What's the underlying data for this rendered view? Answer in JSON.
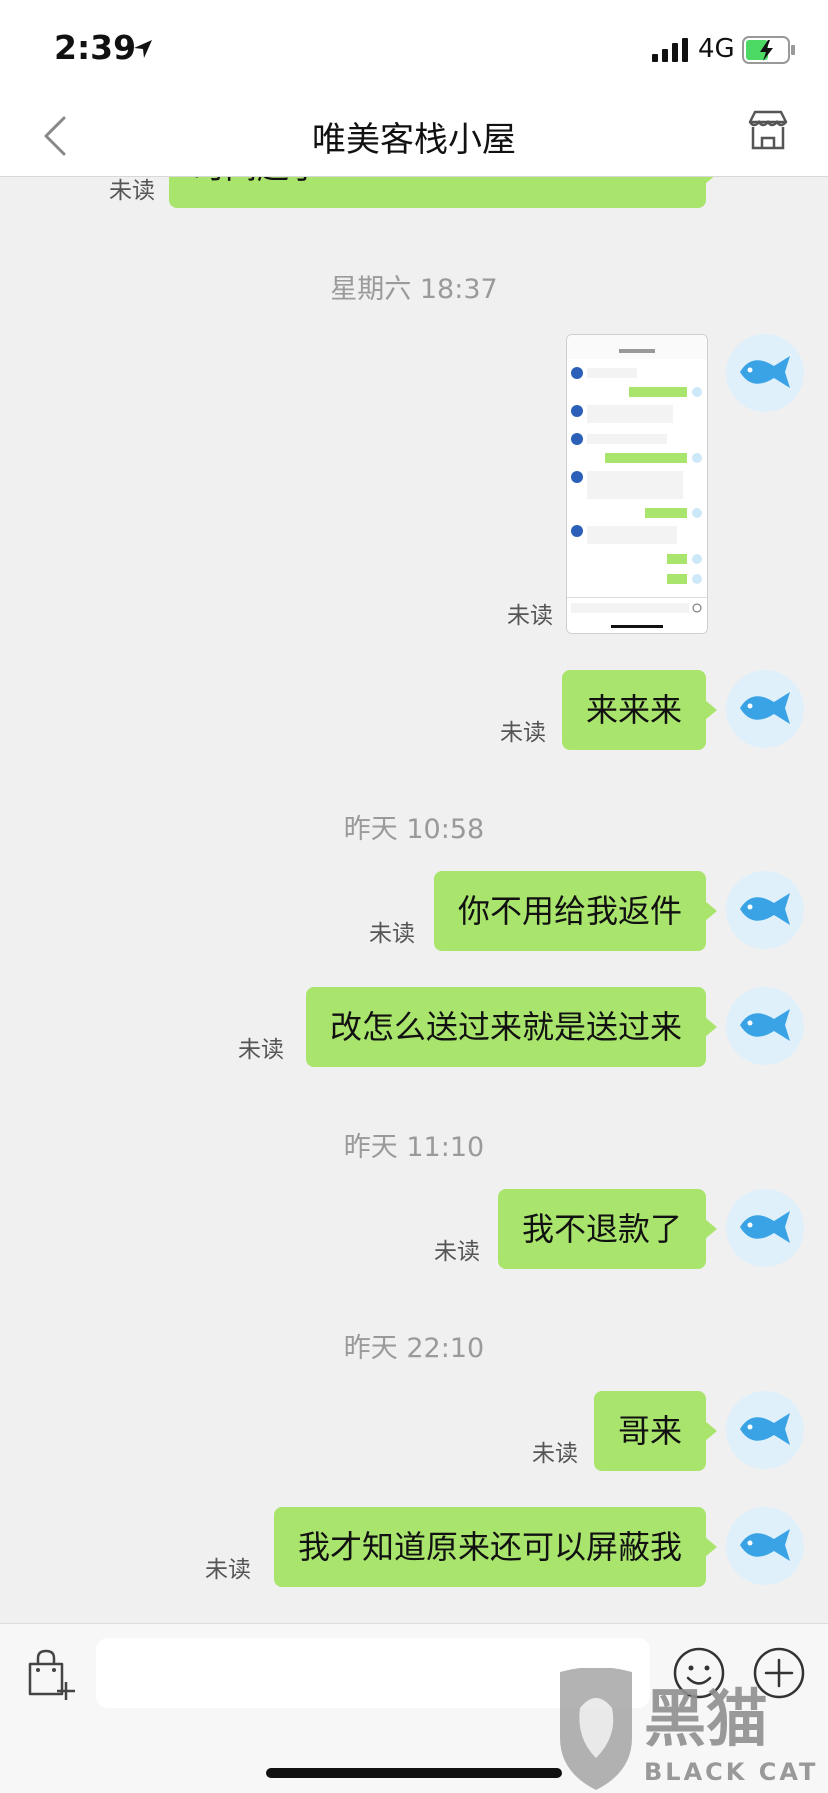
{
  "status_bar": {
    "time": "2:39",
    "network": "4G"
  },
  "nav": {
    "title": "唯美客栈小屋"
  },
  "colors": {
    "bubble": "#a9e46d",
    "unread": "#555555",
    "timestamp": "#9a9a9a",
    "avatar_bg": "#dff0fb",
    "fish": "#3aa3e6"
  },
  "messages": {
    "top_partial": {
      "text": "时间赶了",
      "status": "未读"
    },
    "ts1": "星期六 18:37",
    "image_status": "未读",
    "m1": {
      "text": "来来来",
      "status": "未读"
    },
    "ts2": "昨天 10:58",
    "m2": {
      "text": "你不用给我返件",
      "status": "未读"
    },
    "m3": {
      "text": "改怎么送过来就是送过来",
      "status": "未读"
    },
    "ts3": "昨天 11:10",
    "m4": {
      "text": "我不退款了",
      "status": "未读"
    },
    "ts4": "昨天 22:10",
    "m5": {
      "text": "哥来",
      "status": "未读"
    },
    "m6": {
      "text": "我才知道原来还可以屏蔽我",
      "status": "未读"
    }
  },
  "input": {
    "value": "",
    "placeholder": ""
  },
  "icons": [
    "location-arrow-icon",
    "signal-icon",
    "battery-charging-icon",
    "back-chevron-icon",
    "shop-icon",
    "fish-avatar-icon",
    "shopping-bag-add-icon",
    "emoji-icon",
    "plus-circle-icon"
  ]
}
